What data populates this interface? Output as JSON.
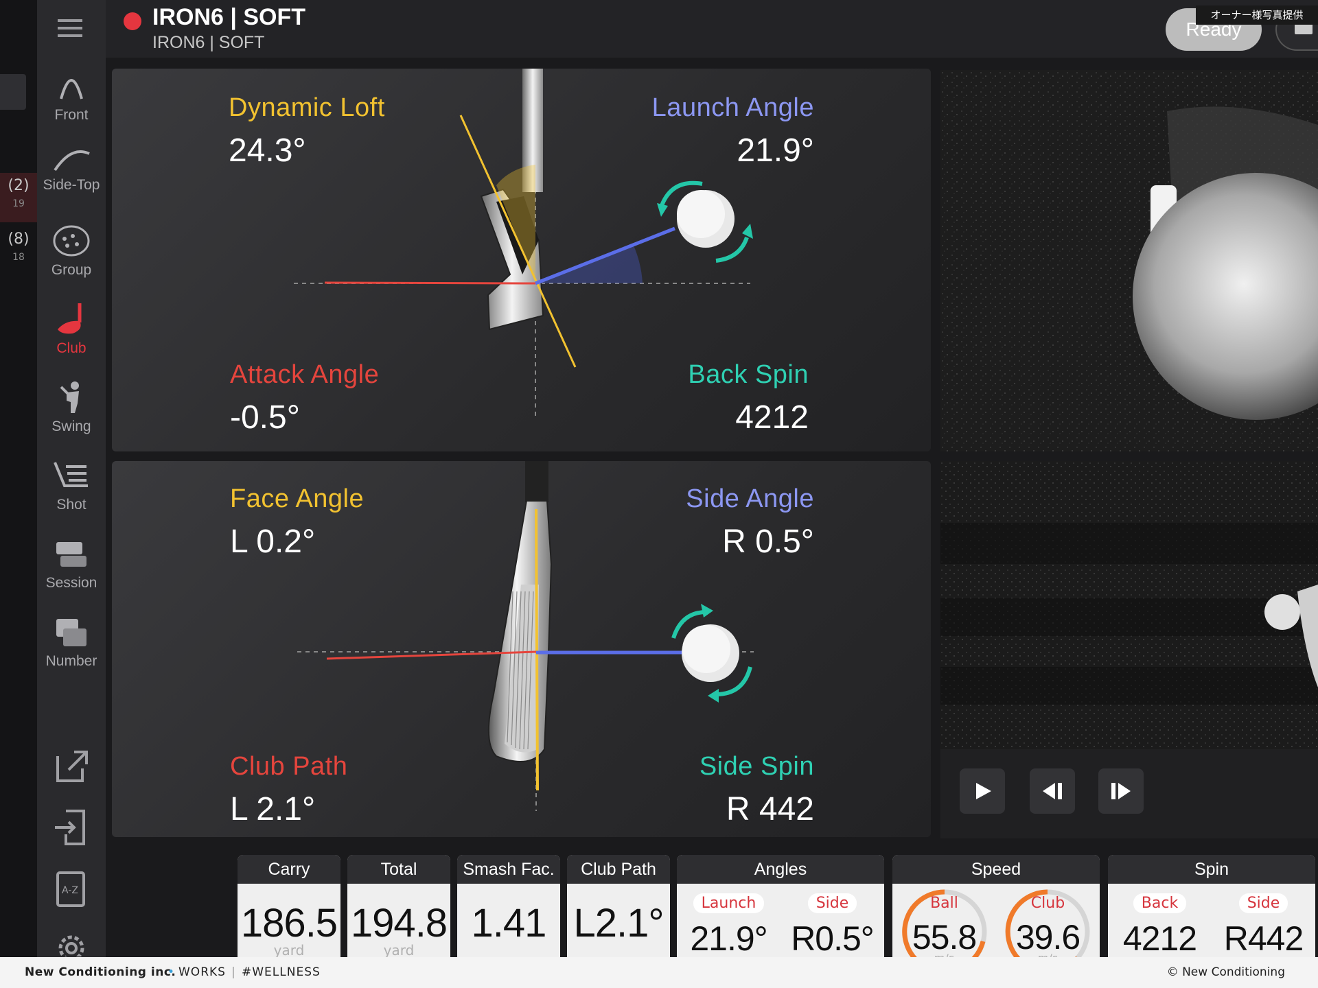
{
  "header": {
    "title": "IRON6 | SOFT",
    "subtitle": "IRON6 | SOFT",
    "status_color": "#e5363f",
    "ready_label": "Ready",
    "photo_credit": "オーナー様写真提供"
  },
  "left_strip": [
    {
      "count": "(2)",
      "sub": "19"
    },
    {
      "count": "(8)",
      "sub": "18"
    }
  ],
  "sidebar": {
    "items": [
      {
        "label": "Front",
        "icon": "front-arc-icon"
      },
      {
        "label": "Side-Top",
        "icon": "side-top-arc-icon"
      },
      {
        "label": "Group",
        "icon": "group-icon"
      },
      {
        "label": "Club",
        "icon": "club-icon",
        "active": true
      },
      {
        "label": "Swing",
        "icon": "swing-icon"
      },
      {
        "label": "Shot",
        "icon": "shot-icon"
      },
      {
        "label": "Session",
        "icon": "session-icon"
      },
      {
        "label": "Number",
        "icon": "number-icon"
      }
    ],
    "tools": [
      "export-icon",
      "import-icon",
      "dictionary-icon",
      "settings-icon"
    ]
  },
  "top_panel": {
    "dynamic_loft": {
      "label": "Dynamic Loft",
      "value": "24.3°"
    },
    "launch_angle": {
      "label": "Launch Angle",
      "value": "21.9°"
    },
    "attack_angle": {
      "label": "Attack Angle",
      "value": "-0.5°"
    },
    "back_spin": {
      "label": "Back Spin",
      "value": "4212"
    }
  },
  "bottom_panel": {
    "face_angle": {
      "label": "Face Angle",
      "value": "L 0.2°"
    },
    "side_angle": {
      "label": "Side Angle",
      "value": "R 0.5°"
    },
    "club_path": {
      "label": "Club Path",
      "value": "L 2.1°"
    },
    "side_spin": {
      "label": "Side Spin",
      "value": "R 442"
    }
  },
  "playback": [
    "play-icon",
    "step-back-icon",
    "step-forward-icon"
  ],
  "stats": {
    "carry": {
      "label": "Carry",
      "value": "186.5",
      "unit": "yard"
    },
    "total": {
      "label": "Total",
      "value": "194.8",
      "unit": "yard"
    },
    "smash": {
      "label": "Smash Fac.",
      "value": "1.41"
    },
    "club_path": {
      "label": "Club Path",
      "value": "L2.1°"
    },
    "angles": {
      "label": "Angles",
      "launch_label": "Launch",
      "launch_value": "21.9°",
      "side_label": "Side",
      "side_value": "R0.5°"
    },
    "speed": {
      "label": "Speed",
      "ball_label": "Ball",
      "ball_value": "55.8",
      "club_label": "Club",
      "club_value": "39.6",
      "unit": "m/s"
    },
    "spin": {
      "label": "Spin",
      "back_label": "Back",
      "back_value": "4212",
      "side_label": "Side",
      "side_value": "R442"
    }
  },
  "footer": {
    "company": "New Conditioning inc.",
    "works": "WORKS",
    "tag": "#WELLNESS",
    "copyright": "© New Conditioning"
  }
}
